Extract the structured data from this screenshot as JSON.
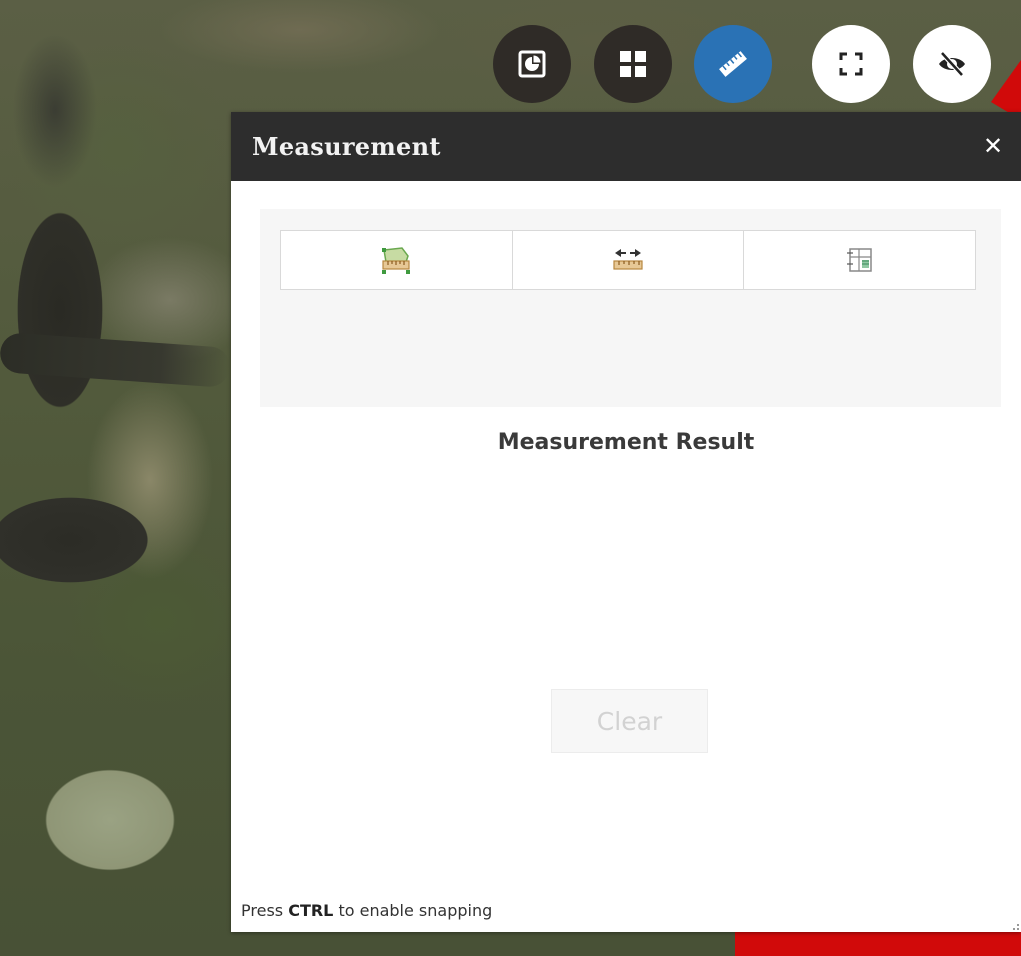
{
  "toolbar": {
    "buttons": [
      {
        "name": "pie-chart-widget-button",
        "icon": "pie-chart-icon",
        "style": "dark"
      },
      {
        "name": "grid-widget-button",
        "icon": "grid-icon",
        "style": "dark"
      },
      {
        "name": "measurement-widget-button",
        "icon": "ruler-icon",
        "style": "blue",
        "active": true
      },
      {
        "name": "fullscreen-button",
        "icon": "fullscreen-icon",
        "style": "white"
      },
      {
        "name": "hide-button",
        "icon": "eye-off-icon",
        "style": "white"
      }
    ]
  },
  "panel": {
    "title": "Measurement",
    "close_label": "✕",
    "tools": [
      {
        "name": "area-tool",
        "icon": "area-measure-icon"
      },
      {
        "name": "distance-tool",
        "icon": "distance-measure-icon"
      },
      {
        "name": "location-tool",
        "icon": "location-measure-icon"
      }
    ],
    "result_title": "Measurement Result",
    "clear_label": "Clear",
    "snap_hint": {
      "prefix": "Press ",
      "key": "CTRL",
      "suffix": " to enable snapping"
    }
  },
  "colors": {
    "header_bg": "#2d2d2d",
    "active_button": "#2a72b5",
    "dark_button": "#2f2b27",
    "map_highlight": "#d10a0a"
  }
}
